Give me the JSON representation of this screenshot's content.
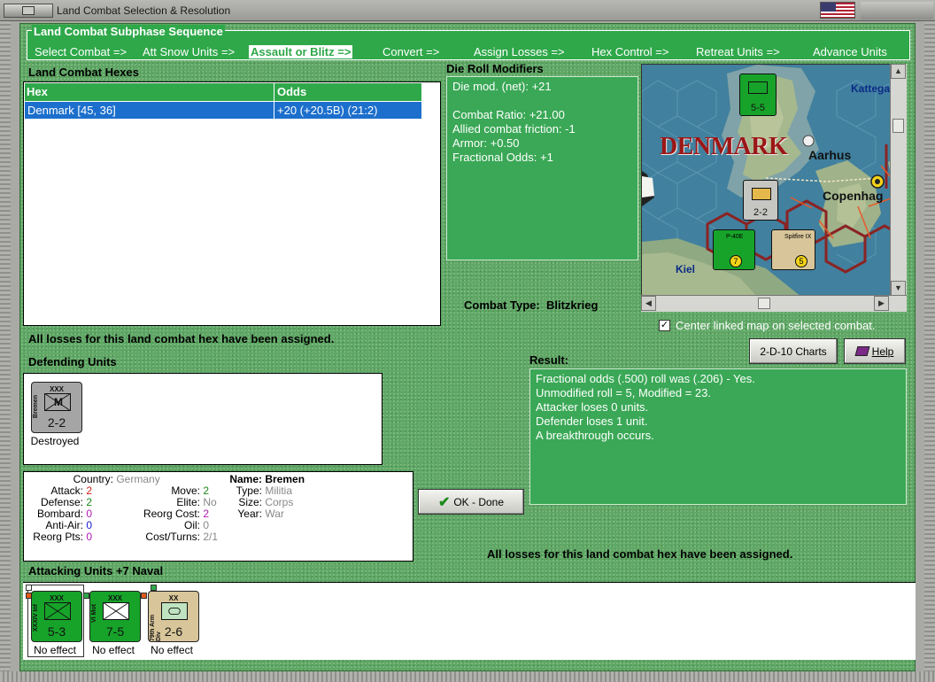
{
  "window": {
    "title": "Land Combat Selection & Resolution"
  },
  "sequence": {
    "title": "Land Combat Subphase Sequence",
    "items": [
      {
        "label": "Select Combat =>",
        "active": false
      },
      {
        "label": "Att Snow Units =>",
        "active": false
      },
      {
        "label": "Assault or Blitz =>",
        "active": true
      },
      {
        "label": "Convert =>",
        "active": false
      },
      {
        "label": "Assign Losses =>",
        "active": false
      },
      {
        "label": "Hex Control =>",
        "active": false
      },
      {
        "label": "Retreat Units =>",
        "active": false
      },
      {
        "label": "Advance Units",
        "active": false
      }
    ]
  },
  "hexes": {
    "title": "Land Combat Hexes",
    "columns": [
      "Hex",
      "Odds"
    ],
    "rows": [
      {
        "hex": "Denmark [45, 36]",
        "odds": "+20 (+20.5B) (21:2)"
      }
    ]
  },
  "die_roll": {
    "title": "Die Roll Modifiers",
    "lines": [
      "Die mod. (net): +21",
      "",
      "Combat Ratio: +21.00",
      "Allied combat friction: -1",
      "Armor: +0.50",
      "Fractional Odds: +1"
    ]
  },
  "map": {
    "labels": [
      "DENMARK",
      "Aarhus",
      "Copenhag",
      "Kattega",
      "Kiel"
    ],
    "units": [
      {
        "strength": "5-5",
        "type": "XXX"
      },
      {
        "strength": "2-2",
        "type": "XXX"
      },
      {
        "label": "Spitfire IX",
        "value": "5"
      },
      {
        "label": "P-40E",
        "value": "7"
      }
    ]
  },
  "combat_type": {
    "label": "Combat Type:",
    "value": "Blitzkrieg"
  },
  "center_map": {
    "label": "Center linked map on selected combat.",
    "checked": true
  },
  "messages": {
    "losses_assigned": "All losses for this land combat hex have been assigned."
  },
  "buttons": {
    "charts": "2-D-10 Charts",
    "help": "Help",
    "ok": "OK - Done"
  },
  "defending": {
    "title": "Defending Units",
    "units": [
      {
        "name": "Bremen",
        "size": "XXX",
        "symbol": "M",
        "strength": "2-2",
        "status": "Destroyed",
        "color": "#a5a5a5"
      }
    ]
  },
  "unit_info": {
    "country_label": "Country:",
    "country": "Germany",
    "attack_label": "Attack:",
    "attack": "2",
    "defense_label": "Defense:",
    "defense": "2",
    "bombard_label": "Bombard:",
    "bombard": "0",
    "antiair_label": "Anti-Air:",
    "antiair": "0",
    "reorgpts_label": "Reorg Pts:",
    "reorgpts": "0",
    "move_label": "Move:",
    "move": "2",
    "elite_label": "Elite:",
    "elite": "No",
    "reorgcost_label": "Reorg Cost:",
    "reorgcost": "2",
    "oil_label": "Oil:",
    "oil": "0",
    "costturns_label": "Cost/Turns:",
    "costturns": "2/1",
    "name_label": "Name:",
    "name": "Bremen",
    "type_label": "Type:",
    "type": "Militia",
    "size_label": "Size:",
    "size": "Corps",
    "year_label": "Year:",
    "year": "War"
  },
  "result": {
    "title": "Result:",
    "lines": [
      "Fractional odds (.500) roll was (.206)  - Yes.",
      "Unmodified roll = 5, Modified = 23.",
      "Attacker loses 0 units.",
      "Defender loses 1 unit.",
      "A breakthrough occurs."
    ]
  },
  "attacking": {
    "title": "Attacking Units +7 Naval",
    "units": [
      {
        "name": "XXXIV Inf",
        "size": "XXX",
        "strength": "5-3",
        "status": "No effect",
        "color": "#17a32a"
      },
      {
        "name": "VI Mot",
        "size": "XXX",
        "strength": "7-5",
        "status": "No effect",
        "color": "#17a32a"
      },
      {
        "name": "79th Arm Div",
        "size": "XX",
        "strength": "2-6",
        "status": "No effect",
        "color": "#d8c69a"
      }
    ]
  },
  "colors": {
    "panel": "#5fa865",
    "accent": "#2fa84a",
    "selection": "#1c6fcc"
  }
}
